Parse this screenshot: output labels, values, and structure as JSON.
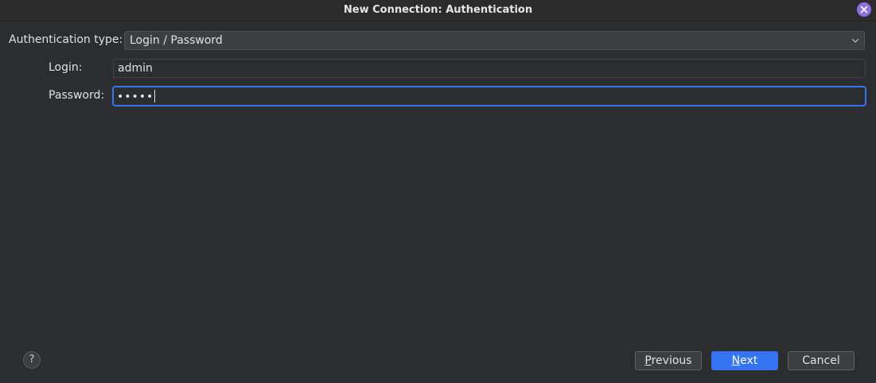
{
  "window": {
    "title": "New Connection: Authentication",
    "close_icon": "close-icon",
    "accent_color": "#8f6ee3"
  },
  "form": {
    "auth_type_label": "Authentication type:",
    "auth_type_value": "Login / Password",
    "auth_type_icon": "chevron-down-icon",
    "login_label": "Login:",
    "login_value": "admin",
    "password_label": "Password:",
    "password_value_masked": "•••••",
    "focus_color": "#3574f0"
  },
  "footer": {
    "help_label": "?",
    "previous_first": "P",
    "previous_rest": "revious",
    "next_first": "N",
    "next_rest": "ext",
    "cancel_label": "Cancel",
    "primary_color": "#3574f0"
  }
}
